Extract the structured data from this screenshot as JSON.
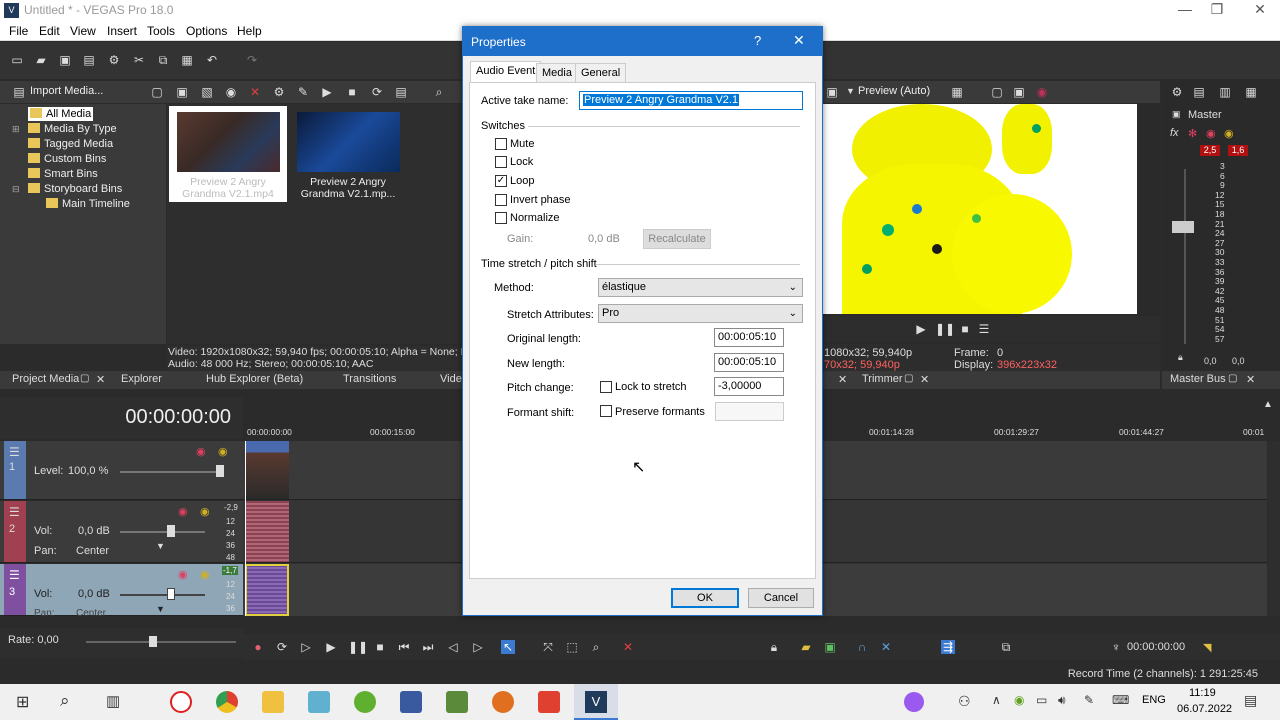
{
  "window": {
    "title": "Untitled * - VEGAS Pro 18.0",
    "app_icon": "V"
  },
  "menu": [
    "File",
    "Edit",
    "View",
    "Insert",
    "Tools",
    "Options",
    "Help"
  ],
  "explorer": {
    "import_label": "Import Media...",
    "tree": [
      "All Media",
      "Media By Type",
      "Tagged Media",
      "Custom Bins",
      "Smart Bins",
      "Storyboard Bins",
      "Main Timeline"
    ],
    "thumbs": [
      {
        "caption": "Preview 2 Angry Grandma V2.1.mp4"
      },
      {
        "caption": "Preview 2 Angry Grandma V2.1.mp..."
      }
    ],
    "media_info_line1": "Video: 1920x1080x32; 59,940 fps; 00:00:05:10; Alpha = None; F",
    "media_info_line2": "Audio: 48 000 Hz; Stereo; 00:00:05:10; AAC",
    "tabs": [
      "Project Media",
      "Explorer",
      "Hub Explorer (Beta)",
      "Transitions",
      "Video"
    ]
  },
  "preview": {
    "label": "Preview (Auto)",
    "info_left1": "1080x32; 59,940p",
    "info_left2": "70x32; 59,940p",
    "frame_label": "Frame:",
    "frame_value": "0",
    "display_label": "Display:",
    "display_value": "396x223x32",
    "trimmer": "Trimmer"
  },
  "master": {
    "label": "Master",
    "peak_left": "2,5",
    "peak_right": "1,6",
    "scale": [
      "3",
      "6",
      "9",
      "12",
      "15",
      "18",
      "21",
      "24",
      "27",
      "30",
      "33",
      "36",
      "39",
      "42",
      "45",
      "48",
      "51",
      "54",
      "57"
    ],
    "bottom_left": "0,0",
    "bottom_right": "0,0",
    "bus_tab": "Master Bus"
  },
  "timeline": {
    "timecode": "00:00:00:00",
    "ruler": [
      "00:00:00:00",
      "00:00:15:00",
      "00:01:14:28",
      "00:01:29:27",
      "00:01:44:27",
      "00:01"
    ],
    "tracks": [
      {
        "num": "1",
        "level_label": "Level:",
        "level_value": "100,0 %"
      },
      {
        "num": "2",
        "vol_label": "Vol:",
        "vol_value": "0,0 dB",
        "pan_label": "Pan:",
        "pan_value": "Center",
        "meter": "-2,9"
      },
      {
        "num": "3",
        "vol_label": "Vol:",
        "vol_value": "0,0 dB",
        "pan_label": "Pan:",
        "pan_value": "Center",
        "meter": "-1,7"
      }
    ],
    "meter_scale": [
      "12",
      "24",
      "36",
      "48"
    ],
    "rate_label": "Rate: 0,00",
    "transport_time": "00:00:00:00",
    "record_time": "Record Time (2 channels): 1 291:25:45"
  },
  "dialog": {
    "title": "Properties",
    "help": "?",
    "tabs": [
      "Audio Event",
      "Media",
      "General"
    ],
    "active_take_label": "Active take name:",
    "active_take_value": "Preview 2 Angry Grandma V2.1",
    "switches_label": "Switches",
    "switches": [
      {
        "label": "Mute",
        "checked": false
      },
      {
        "label": "Lock",
        "checked": false
      },
      {
        "label": "Loop",
        "checked": true
      },
      {
        "label": "Invert phase",
        "checked": false
      },
      {
        "label": "Normalize",
        "checked": false
      }
    ],
    "gain_label": "Gain:",
    "gain_value": "0,0 dB",
    "recalculate": "Recalculate",
    "stretch_group": "Time stretch / pitch shift",
    "method_label": "Method:",
    "method_value": "élastique",
    "attributes_label": "Stretch Attributes:",
    "attributes_value": "Pro",
    "original_length_label": "Original length:",
    "original_length_value": "00:00:05:10",
    "new_length_label": "New length:",
    "new_length_value": "00:00:05:10",
    "pitch_label": "Pitch change:",
    "lock_stretch_label": "Lock to stretch",
    "pitch_value": "-3,00000",
    "formant_label": "Formant shift:",
    "preserve_formants_label": "Preserve formants",
    "ok": "OK",
    "cancel": "Cancel"
  },
  "taskbar": {
    "lang": "ENG",
    "time": "11:19",
    "date": "06.07.2022"
  }
}
